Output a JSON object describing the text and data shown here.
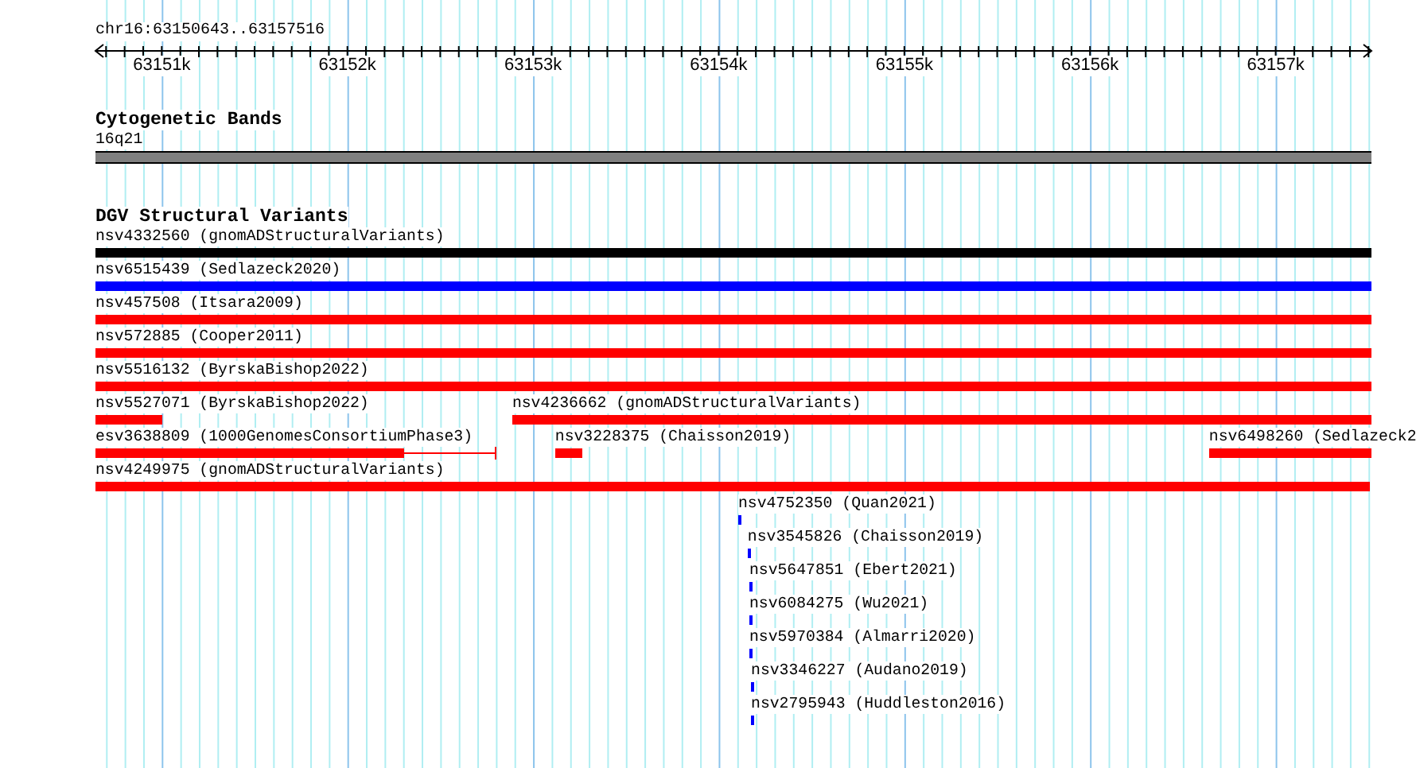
{
  "ruler": {
    "location": "chr16:63150643..63157516",
    "ticks": [
      {
        "label": "63151k"
      },
      {
        "label": "63152k"
      },
      {
        "label": "63153k"
      },
      {
        "label": "63154k"
      },
      {
        "label": "63155k"
      },
      {
        "label": "63156k"
      },
      {
        "label": "63157k"
      }
    ]
  },
  "tracks": [
    {
      "title": "Cytogenetic Bands",
      "kind": "bands",
      "rows": [
        [
          {
            "label": "16q21"
          }
        ]
      ]
    },
    {
      "title": "DGV Structural Variants",
      "kind": "variants",
      "rows": [
        [
          {
            "label": "nsv4332560 (gnomADStructuralVariants)",
            "color": "#000000"
          }
        ],
        [
          {
            "label": "nsv6515439 (Sedlazeck2020)",
            "color": "#0000ff"
          }
        ],
        [
          {
            "label": "nsv457508 (Itsara2009)",
            "color": "#ff0000"
          }
        ],
        [
          {
            "label": "nsv572885 (Cooper2011)",
            "color": "#ff0000"
          }
        ],
        [
          {
            "label": "nsv5516132 (ByrskaBishop2022)",
            "color": "#ff0000"
          }
        ],
        [
          {
            "label": "nsv5527071 (ByrskaBishop2022)",
            "color": "#ff0000"
          },
          {
            "label": "nsv4236662 (gnomADStructuralVariants)",
            "color": "#ff0000"
          }
        ],
        [
          {
            "label": "esv3638809 (1000GenomesConsortiumPhase3)",
            "color": "#ff0000"
          },
          {
            "label": "nsv3228375 (Chaisson2019)",
            "color": "#ff0000"
          },
          {
            "label": "nsv6498260 (Sedlazeck2",
            "color": "#ff0000"
          }
        ],
        [
          {
            "label": "nsv4249975 (gnomADStructuralVariants)",
            "color": "#ff0000"
          }
        ],
        [
          {
            "label": "nsv4752350 (Quan2021)",
            "color": "#0000ff"
          }
        ],
        [
          {
            "label": "nsv3545826 (Chaisson2019)",
            "color": "#0000ff"
          }
        ],
        [
          {
            "label": "nsv5647851 (Ebert2021)",
            "color": "#0000ff"
          }
        ],
        [
          {
            "label": "nsv6084275 (Wu2021)",
            "color": "#0000ff"
          }
        ],
        [
          {
            "label": "nsv5970384 (Almarri2020)",
            "color": "#0000ff"
          }
        ],
        [
          {
            "label": "nsv3346227 (Audano2019)",
            "color": "#0000ff"
          }
        ],
        [
          {
            "label": "nsv2795943 (Huddleston2016)",
            "color": "#0000ff"
          }
        ]
      ]
    }
  ]
}
